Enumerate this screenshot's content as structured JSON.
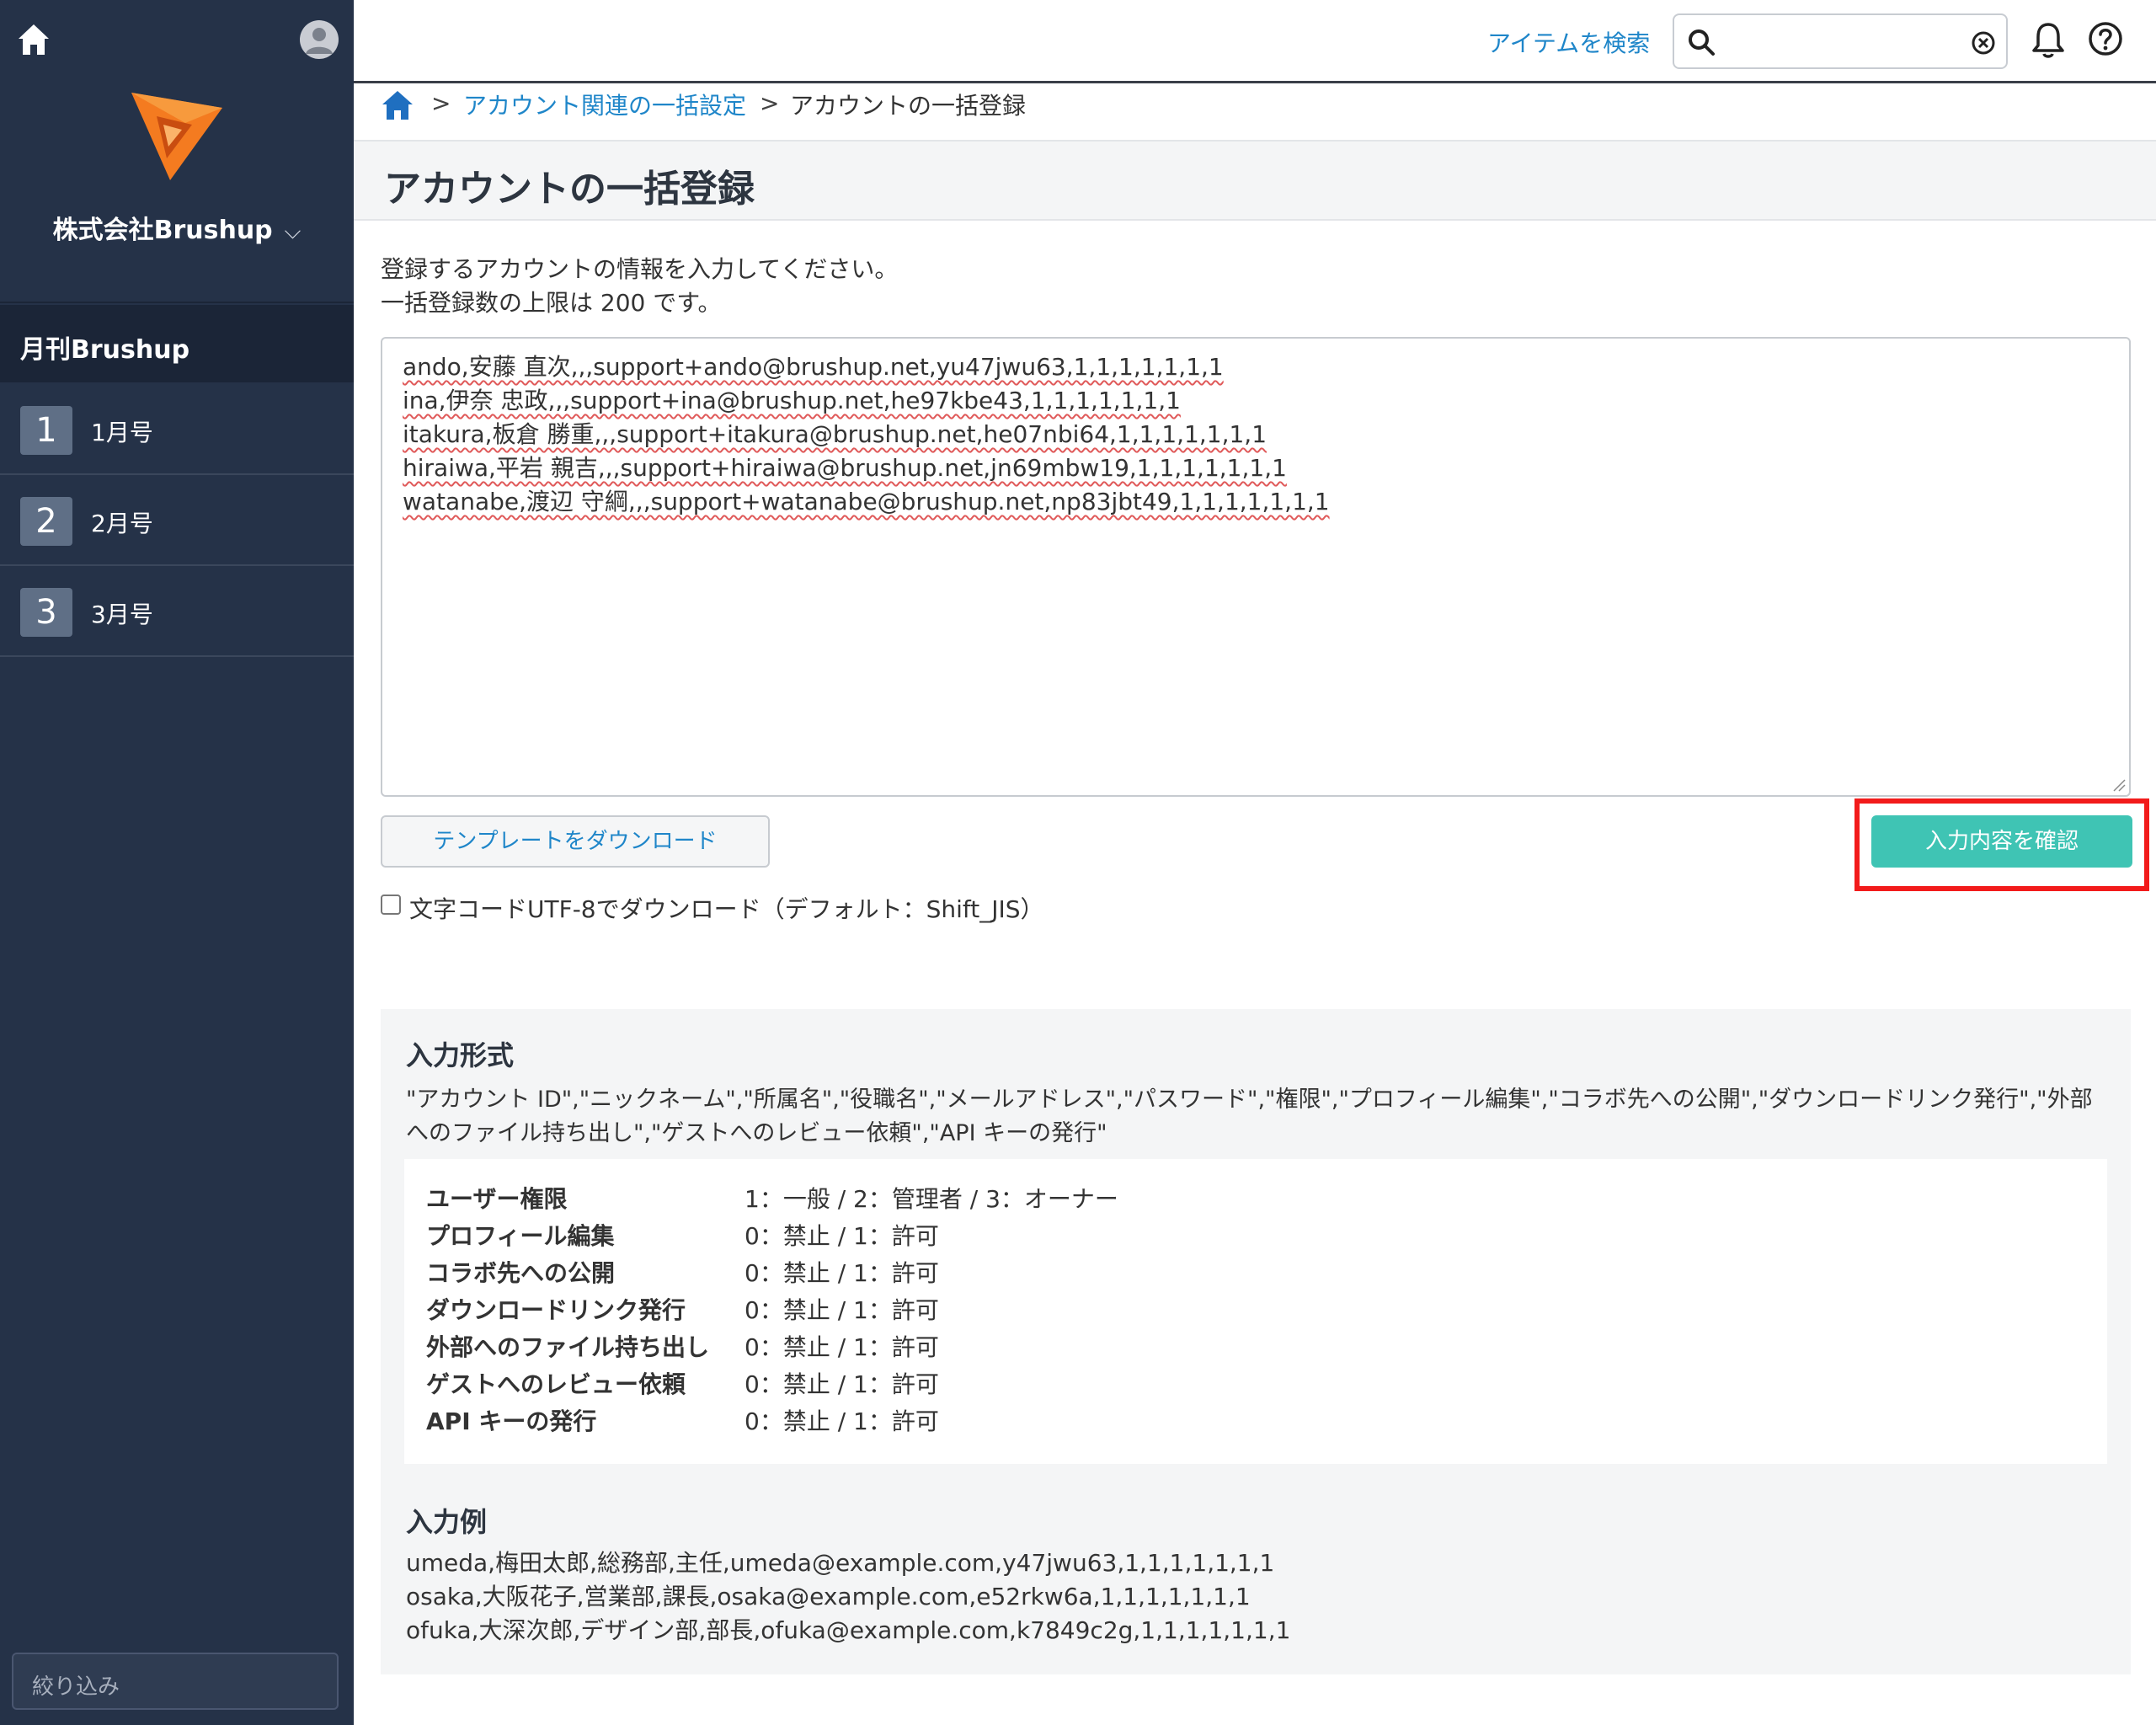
{
  "sidebar": {
    "company": "株式会社Brushup",
    "project": "月刊Brushup",
    "items": [
      {
        "num": "1",
        "label": "1月号"
      },
      {
        "num": "2",
        "label": "2月号"
      },
      {
        "num": "3",
        "label": "3月号"
      }
    ],
    "filter_placeholder": "絞り込み"
  },
  "topbar": {
    "search_link": "アイテムを検索",
    "search_value": ""
  },
  "breadcrumb": {
    "sep": ">",
    "parent": "アカウント関連の一括設定",
    "current": "アカウントの一括登録"
  },
  "page": {
    "title": "アカウントの一括登録",
    "intro_line1": "登録するアカウントの情報を入力してください。",
    "intro_line2": "一括登録数の上限は 200 です。"
  },
  "textarea": {
    "lines": [
      "ando,安藤 直次,,,support+ando@brushup.net,yu47jwu63,1,1,1,1,1,1,1",
      "ina,伊奈 忠政,,,support+ina@brushup.net,he97kbe43,1,1,1,1,1,1,1",
      "itakura,板倉 勝重,,,support+itakura@brushup.net,he07nbi64,1,1,1,1,1,1,1",
      "hiraiwa,平岩 親吉,,,support+hiraiwa@brushup.net,jn69mbw19,1,1,1,1,1,1,1",
      "watanabe,渡辺 守綱,,,support+watanabe@brushup.net,np83jbt49,1,1,1,1,1,1,1"
    ]
  },
  "buttons": {
    "template": "テンプレートをダウンロード",
    "confirm": "入力内容を確認"
  },
  "checkbox": {
    "label": "文字コードUTF-8でダウンロード（デフォルト：Shift_JIS）",
    "checked": false
  },
  "info": {
    "format_heading": "入力形式",
    "format_desc": "\"アカウント ID\",\"ニックネーム\",\"所属名\",\"役職名\",\"メールアドレス\",\"パスワード\",\"権限\",\"プロフィール編集\",\"コラボ先への公開\",\"ダウンロードリンク発行\",\"外部へのファイル持ち出し\",\"ゲストへのレビュー依頼\",\"API キーの発行\"",
    "spec": [
      {
        "key": "ユーザー権限",
        "value": "1：一般 / 2：管理者 / 3：オーナー"
      },
      {
        "key": "プロフィール編集",
        "value": "0：禁止 / 1：許可"
      },
      {
        "key": "コラボ先への公開",
        "value": "0：禁止 / 1：許可"
      },
      {
        "key": "ダウンロードリンク発行",
        "value": "0：禁止 / 1：許可"
      },
      {
        "key": "外部へのファイル持ち出し",
        "value": "0：禁止 / 1：許可"
      },
      {
        "key": "ゲストへのレビュー依頼",
        "value": "0：禁止 / 1：許可"
      },
      {
        "key": "API キーの発行",
        "value": "0：禁止 / 1：許可"
      }
    ],
    "example_heading": "入力例",
    "examples": [
      "umeda,梅田太郎,総務部,主任,umeda@example.com,y47jwu63,1,1,1,1,1,1,1",
      "osaka,大阪花子,営業部,課長,osaka@example.com,e52rkw6a,1,1,1,1,1,1,1",
      "ofuka,大深次郎,デザイン部,部長,ofuka@example.com,k7849c2g,1,1,1,1,1,1,1"
    ]
  },
  "colors": {
    "sidebar_bg": "#253248",
    "accent_teal": "#3fc4b4",
    "link_blue": "#1f86c9",
    "highlight_red": "#f21b1b",
    "logo_orange": "#f47b20"
  }
}
